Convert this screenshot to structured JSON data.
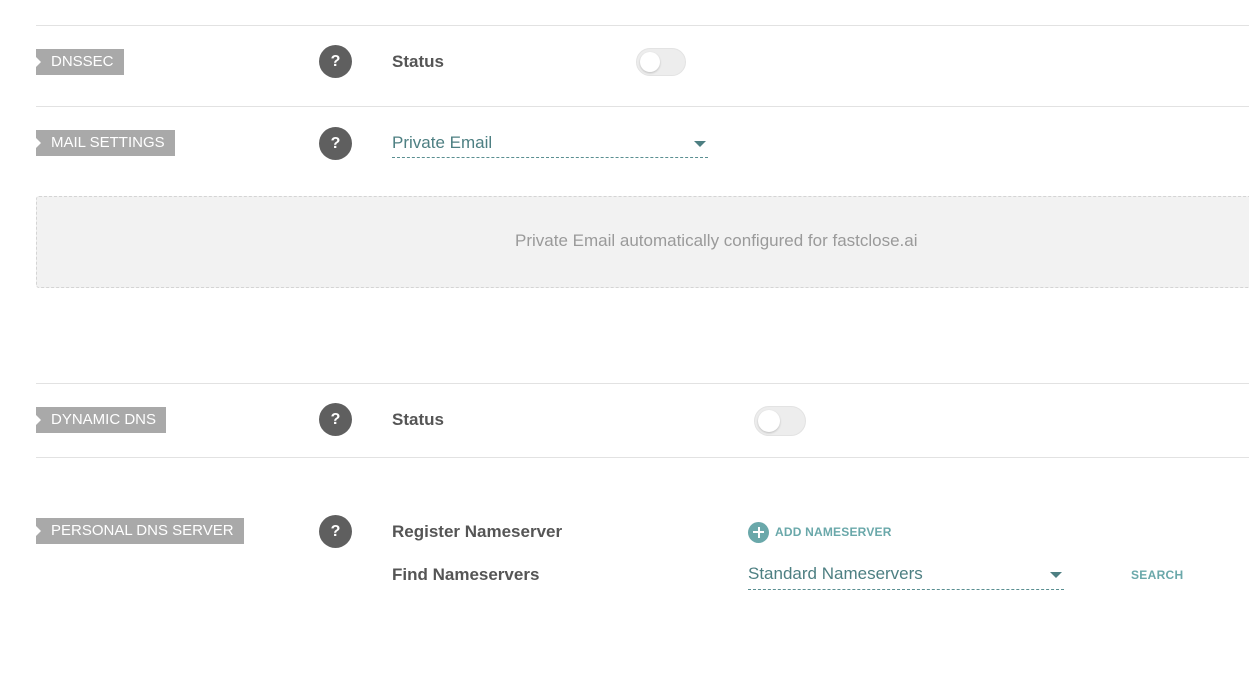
{
  "dnssec": {
    "tag": "DNSSEC",
    "help": "?",
    "status_label": "Status",
    "enabled": false
  },
  "mail_settings": {
    "tag": "MAIL SETTINGS",
    "help": "?",
    "selected": "Private Email",
    "info": "Private Email automatically configured for fastclose.ai"
  },
  "dynamic_dns": {
    "tag": "DYNAMIC DNS",
    "help": "?",
    "status_label": "Status",
    "enabled": false
  },
  "personal_dns": {
    "tag": "PERSONAL DNS SERVER",
    "help": "?",
    "register_label": "Register Nameserver",
    "add_label": "ADD NAMESERVER",
    "find_label": "Find Nameservers",
    "find_selected": "Standard Nameservers",
    "search_label": "SEARCH"
  },
  "colors": {
    "accent": "#6aa8aa",
    "tag_bg": "#a9a9a9",
    "help_bg": "#5f5f5f"
  }
}
